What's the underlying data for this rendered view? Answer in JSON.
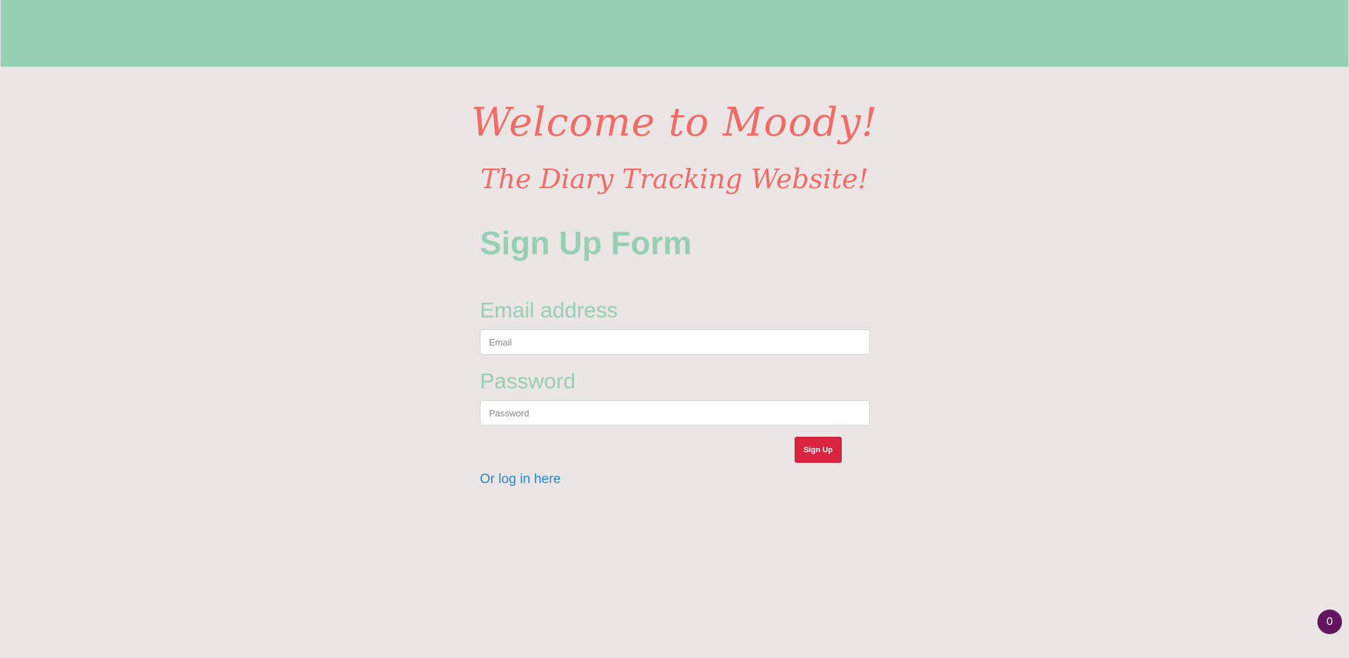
{
  "header": {
    "color": "#97cfb3"
  },
  "hero": {
    "title": "Welcome to Moody!",
    "subtitle": "The Diary Tracking Website!",
    "color": "#f36b67"
  },
  "form": {
    "title": "Sign Up Form",
    "email": {
      "label": "Email address",
      "placeholder": "Email",
      "value": ""
    },
    "password": {
      "label": "Password",
      "placeholder": "Password",
      "value": ""
    },
    "submit_label": "Sign Up",
    "login_link": "Or log in here"
  },
  "badge": {
    "count": "0",
    "color": "#63155f"
  }
}
